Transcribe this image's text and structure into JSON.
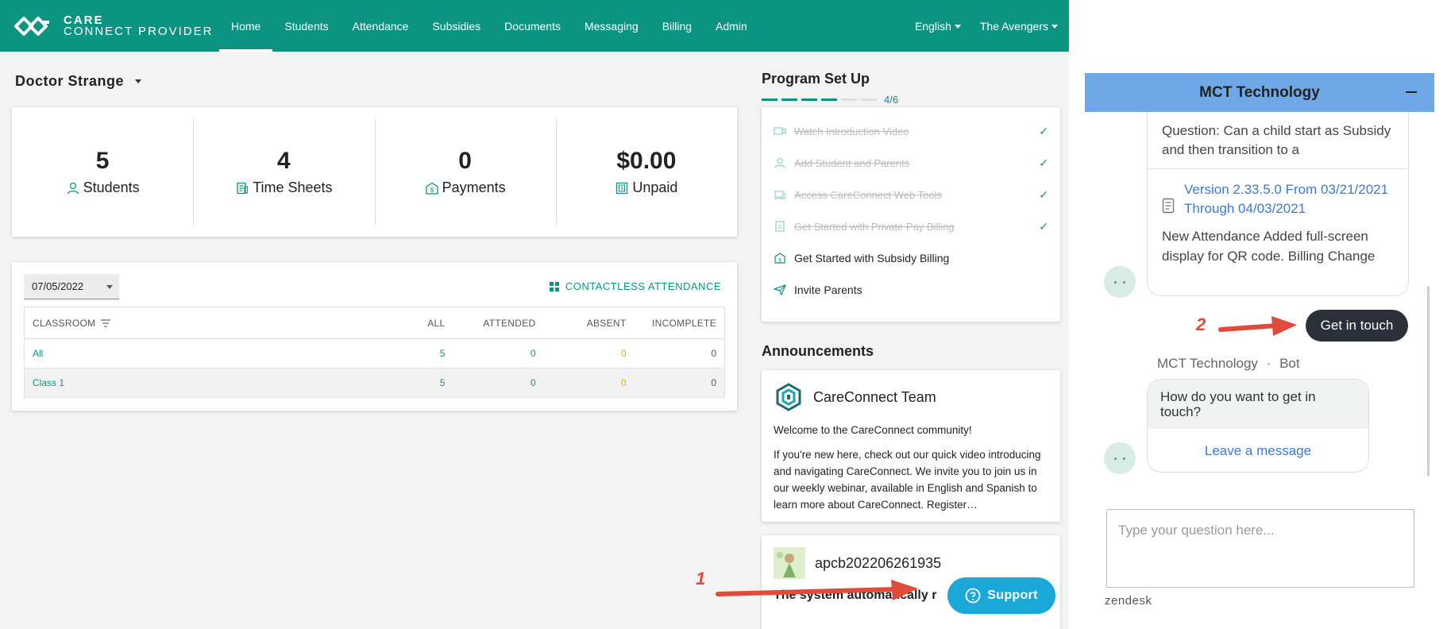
{
  "header": {
    "logo_line1": "CARE",
    "logo_line2": "CONNECT PROVIDER",
    "nav": [
      "Home",
      "Students",
      "Attendance",
      "Subsidies",
      "Documents",
      "Messaging",
      "Billing",
      "Admin"
    ],
    "active_nav": "Home",
    "language": "English",
    "account": "The Avengers"
  },
  "provider": {
    "name": "Doctor Strange"
  },
  "stats": [
    {
      "value": "5",
      "label": "Students",
      "icon": "user-icon"
    },
    {
      "value": "4",
      "label": "Time Sheets",
      "icon": "timesheet-icon"
    },
    {
      "value": "0",
      "label": "Payments",
      "icon": "payment-icon"
    },
    {
      "value": "$0.00",
      "label": "Unpaid",
      "icon": "invoice-icon"
    }
  ],
  "attendance": {
    "date": "07/05/2022",
    "contactless_label": "CONTACTLESS ATTENDANCE",
    "columns": [
      "CLASSROOM",
      "ALL",
      "ATTENDED",
      "ABSENT",
      "INCOMPLETE"
    ],
    "rows": [
      {
        "classroom": "All",
        "all": "5",
        "attended": "0",
        "absent": "0",
        "incomplete": "0"
      },
      {
        "classroom": "Class 1",
        "all": "5",
        "attended": "0",
        "absent": "0",
        "incomplete": "0"
      }
    ]
  },
  "program_setup": {
    "title": "Program Set Up",
    "progress_text": "4/6",
    "progress_done": 4,
    "progress_total": 6,
    "tasks": [
      {
        "label": "Watch Introduction Video",
        "done": true,
        "icon": "video-icon"
      },
      {
        "label": "Add Student and Parents",
        "done": true,
        "icon": "user-icon"
      },
      {
        "label": "Access CareConnect Web Tools",
        "done": true,
        "icon": "tools-icon"
      },
      {
        "label": "Get Started with Private Pay Billing",
        "done": true,
        "icon": "billing-icon"
      },
      {
        "label": "Get Started with Subsidy Billing",
        "done": false,
        "icon": "subsidy-icon"
      },
      {
        "label": "Invite Parents",
        "done": false,
        "icon": "send-icon"
      }
    ]
  },
  "announcements": {
    "title": "Announcements",
    "items": [
      {
        "author": "CareConnect Team",
        "headline": "Welcome to the CareConnect community!",
        "body": "If you're new here, check out our quick video introducing and navigating CareConnect. We invite you to join us in our weekly webinar, available in English and Spanish to learn more about CareConnect. Register…"
      },
      {
        "author": "apcb202206261935",
        "body": "The system automatically r"
      }
    ]
  },
  "support_button": "Support",
  "annotations": {
    "marker1": "1",
    "marker2": "2"
  },
  "chat": {
    "title": "MCT Technology",
    "question": "Question: Can a child start as Subsidy and then transition to a",
    "version_link": "Version 2.33.5.0 From 03/21/2021 Through 04/03/2021",
    "description": "New Attendance Added full-screen display for QR code. Billing Change",
    "get_in_touch": "Get in touch",
    "bot_name": "MCT Technology",
    "bot_separator": "·",
    "bot_tag": "Bot",
    "prompt": "How do you want to get in touch?",
    "leave_message": "Leave a message",
    "input_placeholder": "Type your question here...",
    "footer": "zendesk"
  },
  "colors": {
    "brand": "#0c9483",
    "chat_header": "#6fa8e6",
    "support": "#1aa8d8",
    "absent": "#e8a900",
    "annotation_arrow": "#e04b3c"
  }
}
